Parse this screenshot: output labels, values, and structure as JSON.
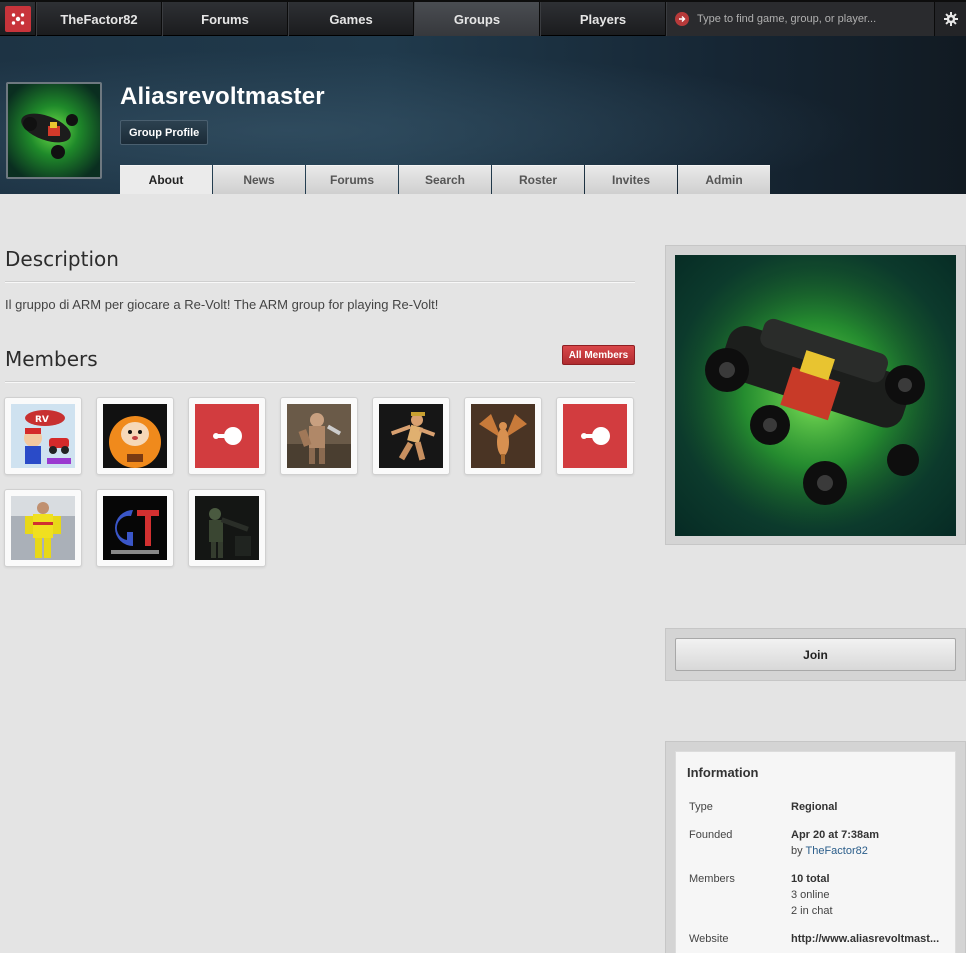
{
  "topnav": {
    "user": "TheFactor82",
    "items": [
      {
        "label": "Forums",
        "active": false
      },
      {
        "label": "Games",
        "active": false
      },
      {
        "label": "Groups",
        "active": true
      },
      {
        "label": "Players",
        "active": false
      }
    ],
    "search_placeholder": "Type to find game, group, or player...",
    "icons": {
      "logo": "site-logo-icon",
      "search": "search-arrow-icon",
      "settings": "gear-icon"
    }
  },
  "header": {
    "group_name": "Aliasrevoltmaster",
    "profile_button": "Group Profile",
    "tabs": [
      {
        "label": "About",
        "active": true
      },
      {
        "label": "News",
        "active": false
      },
      {
        "label": "Forums",
        "active": false
      },
      {
        "label": "Search",
        "active": false
      },
      {
        "label": "Roster",
        "active": false
      },
      {
        "label": "Invites",
        "active": false
      },
      {
        "label": "Admin",
        "active": false
      }
    ]
  },
  "description": {
    "title": "Description",
    "text": "Il gruppo di ARM per giocare a Re-Volt! The ARM group for playing Re-Volt!"
  },
  "members": {
    "title": "Members",
    "all_button": "All Members",
    "avatars": [
      "revolt-mario-avatar",
      "kenny-avatar",
      "default-avatar",
      "warrior-avatar",
      "runner-avatar",
      "dragon-avatar",
      "default-avatar",
      "racer-avatar",
      "gt-logo-avatar",
      "soldier-avatar"
    ]
  },
  "sidebar": {
    "join_label": "Join",
    "info": {
      "title": "Information",
      "rows": [
        {
          "label": "Type",
          "lines": [
            "Regional"
          ]
        },
        {
          "label": "Founded",
          "lines": [
            "Apr 20 at 7:38am"
          ],
          "by_prefix": "by",
          "by_user": "TheFactor82"
        },
        {
          "label": "Members",
          "lines": [
            "10 total",
            "3 online",
            "2 in chat"
          ]
        },
        {
          "label": "Website",
          "link": "http://www.aliasrevoltmast..."
        }
      ]
    }
  }
}
